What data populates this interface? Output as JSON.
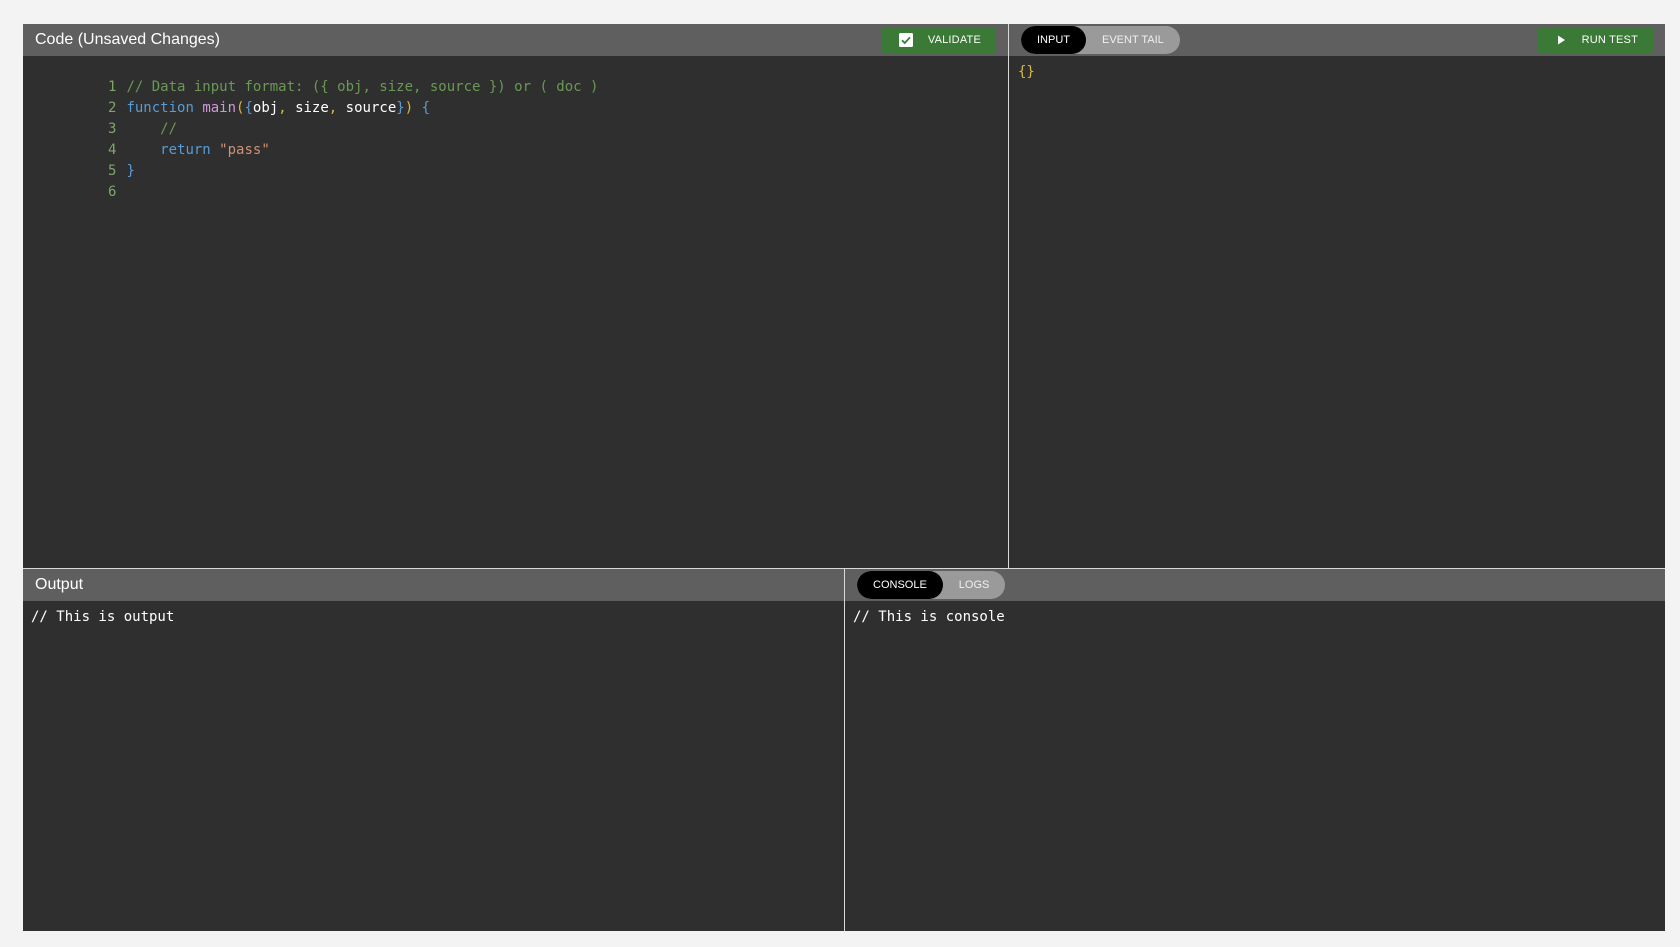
{
  "code_panel": {
    "title": "Code (Unsaved Changes)",
    "validate_label": "VALIDATE",
    "validate_icon": "checkbox-checked-icon",
    "lines": [
      {
        "num": "1",
        "text": "// Data input format: ({ obj, size, source }) or ( doc )"
      },
      {
        "num": "2",
        "text": "function main({obj, size, source}) {"
      },
      {
        "num": "3",
        "text": "    //"
      },
      {
        "num": "4",
        "text": "    return \"pass\""
      },
      {
        "num": "5",
        "text": "}"
      },
      {
        "num": "6",
        "text": ""
      }
    ]
  },
  "input_panel": {
    "tabs": [
      {
        "label": "INPUT",
        "active": true
      },
      {
        "label": "EVENT TAIL",
        "active": false
      }
    ],
    "run_test_label": "RUN TEST",
    "run_test_icon": "play-icon",
    "content": "{}"
  },
  "output_panel": {
    "title": "Output",
    "content": "// This is output"
  },
  "console_panel": {
    "tabs": [
      {
        "label": "CONSOLE",
        "active": true
      },
      {
        "label": "LOGS",
        "active": false
      }
    ],
    "content": "// This is console"
  },
  "colors": {
    "header_bg": "#5f5f5f",
    "panel_bg": "#2f2f2f",
    "accent_green": "#3b7a36",
    "page_bg": "#f3f3f3"
  }
}
